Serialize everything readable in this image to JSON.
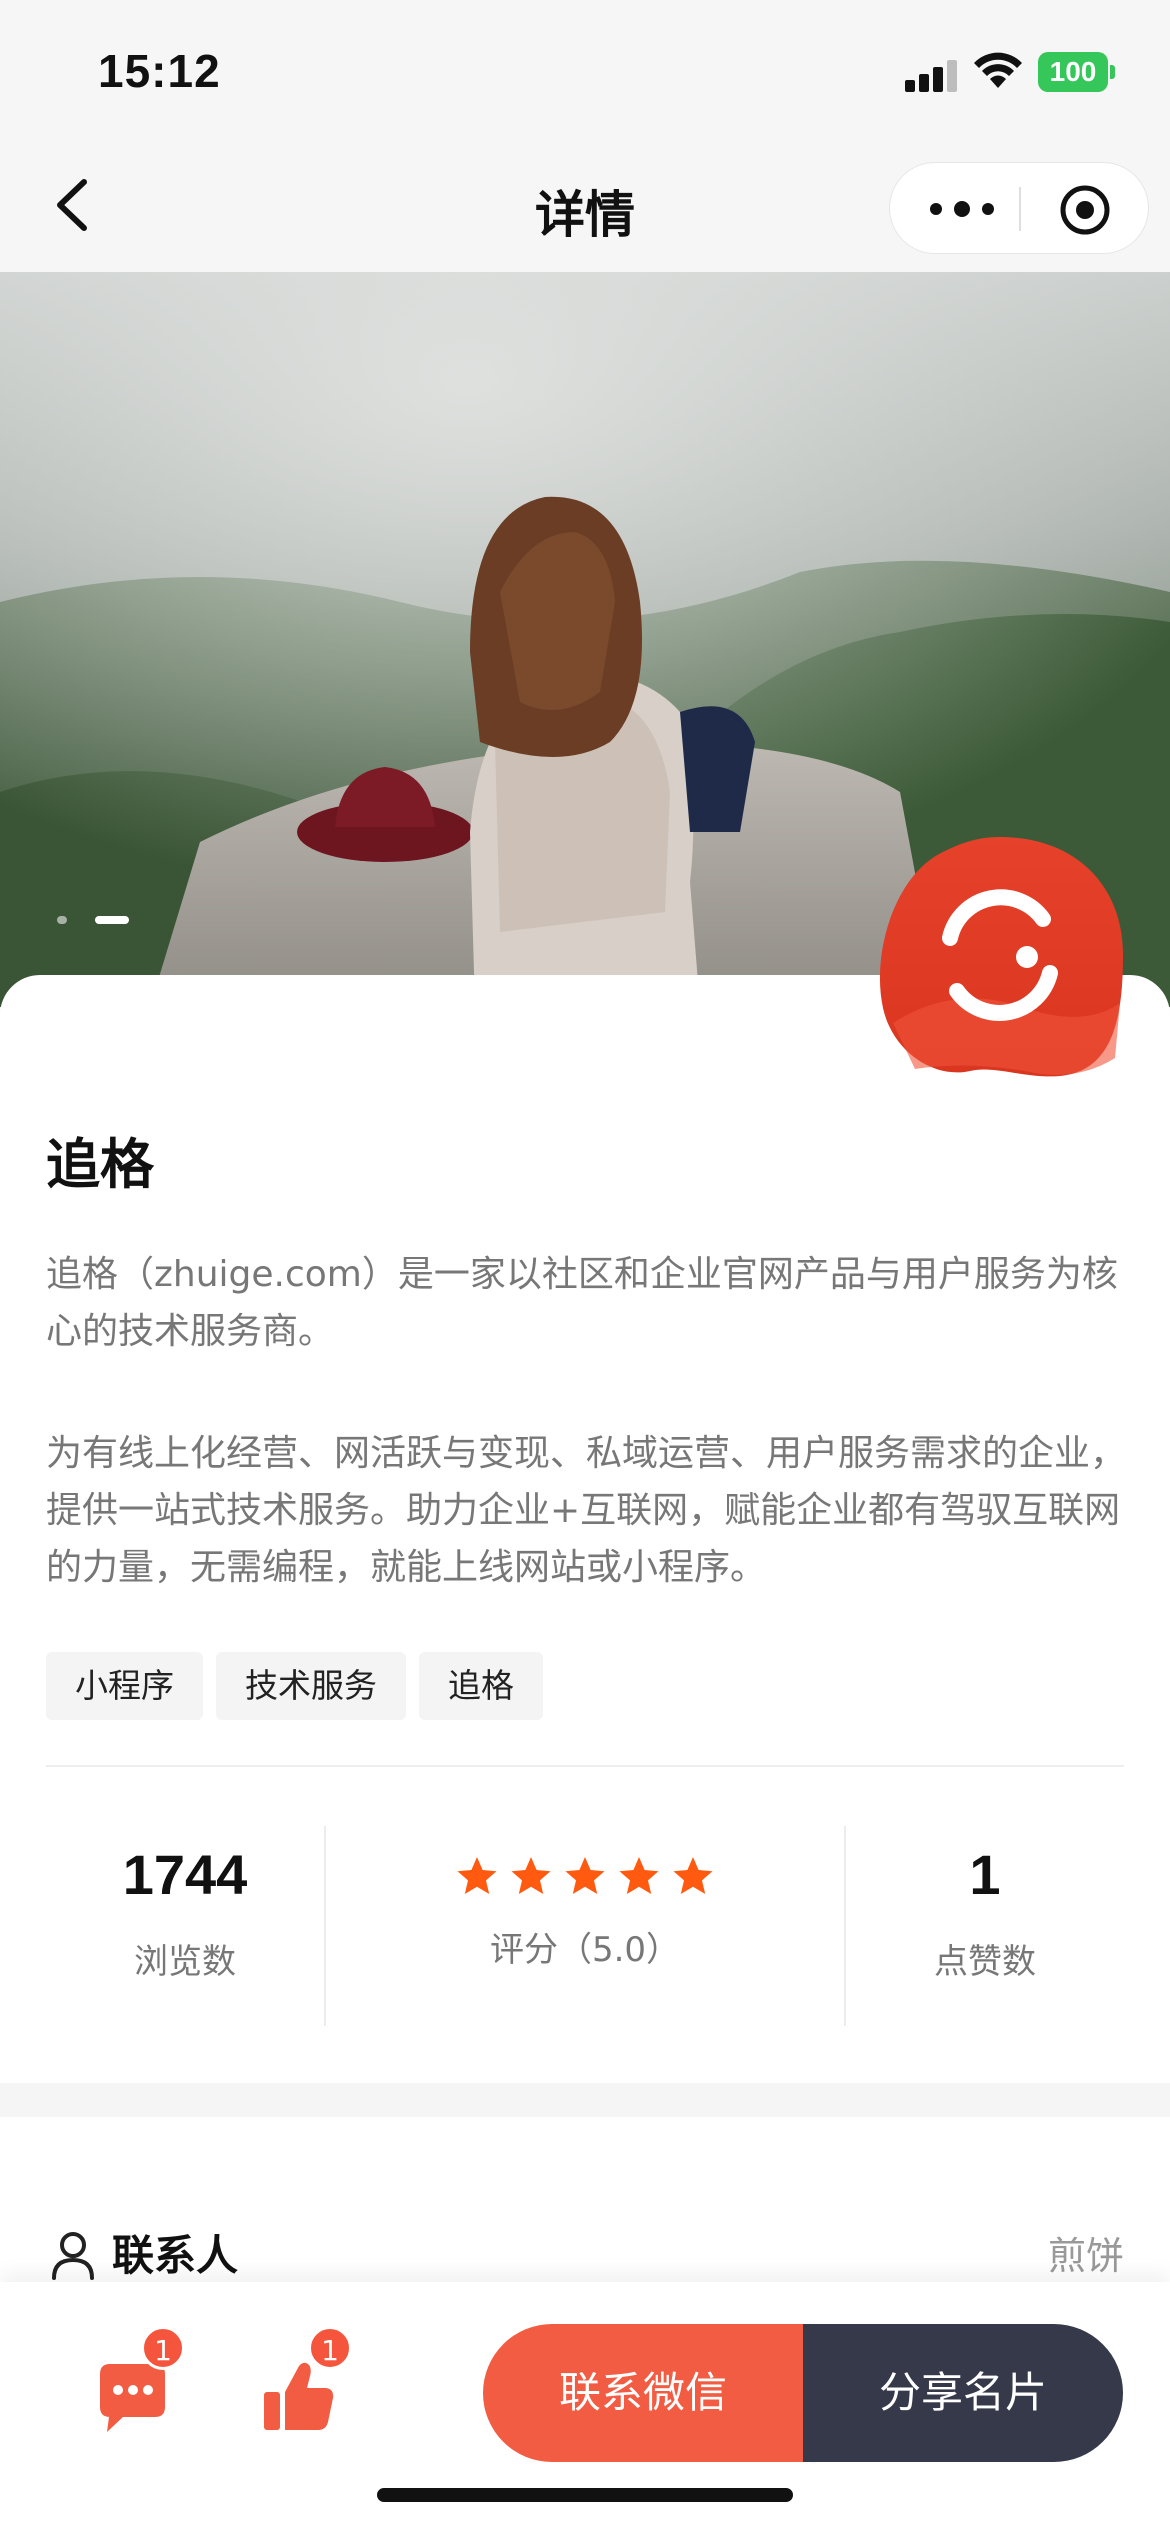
{
  "status_bar": {
    "time": "15:12",
    "battery": "100"
  },
  "nav": {
    "title": "详情"
  },
  "hero": {
    "slide_count": 2,
    "active_slide": 2
  },
  "company": {
    "name": "追格",
    "description_1": "追格（zhuige.com）是一家以社区和企业官网产品与用户服务为核心的技术服务商。",
    "description_2": "为有线上化经营、网活跃与变现、私域运营、用户服务需求的企业，提供一站式技术服务。助力企业+互联网，赋能企业都有驾驭互联网的力量，无需编程，就能上线网站或小程序。",
    "tags": [
      "小程序",
      "技术服务",
      "追格"
    ]
  },
  "stats": {
    "views_value": "1744",
    "views_label": "浏览数",
    "rating": 5.0,
    "rating_label": "评分（5.0）",
    "likes_value": "1",
    "likes_label": "点赞数"
  },
  "contact": {
    "label": "联系人",
    "name": "煎饼"
  },
  "bottom_bar": {
    "comment_badge": "1",
    "like_badge": "1",
    "wechat_button": "联系微信",
    "share_button": "分享名片"
  },
  "colors": {
    "accent": "#f25c43",
    "star": "#ff5a0f",
    "dark_button": "#36394a",
    "battery": "#35c759"
  }
}
